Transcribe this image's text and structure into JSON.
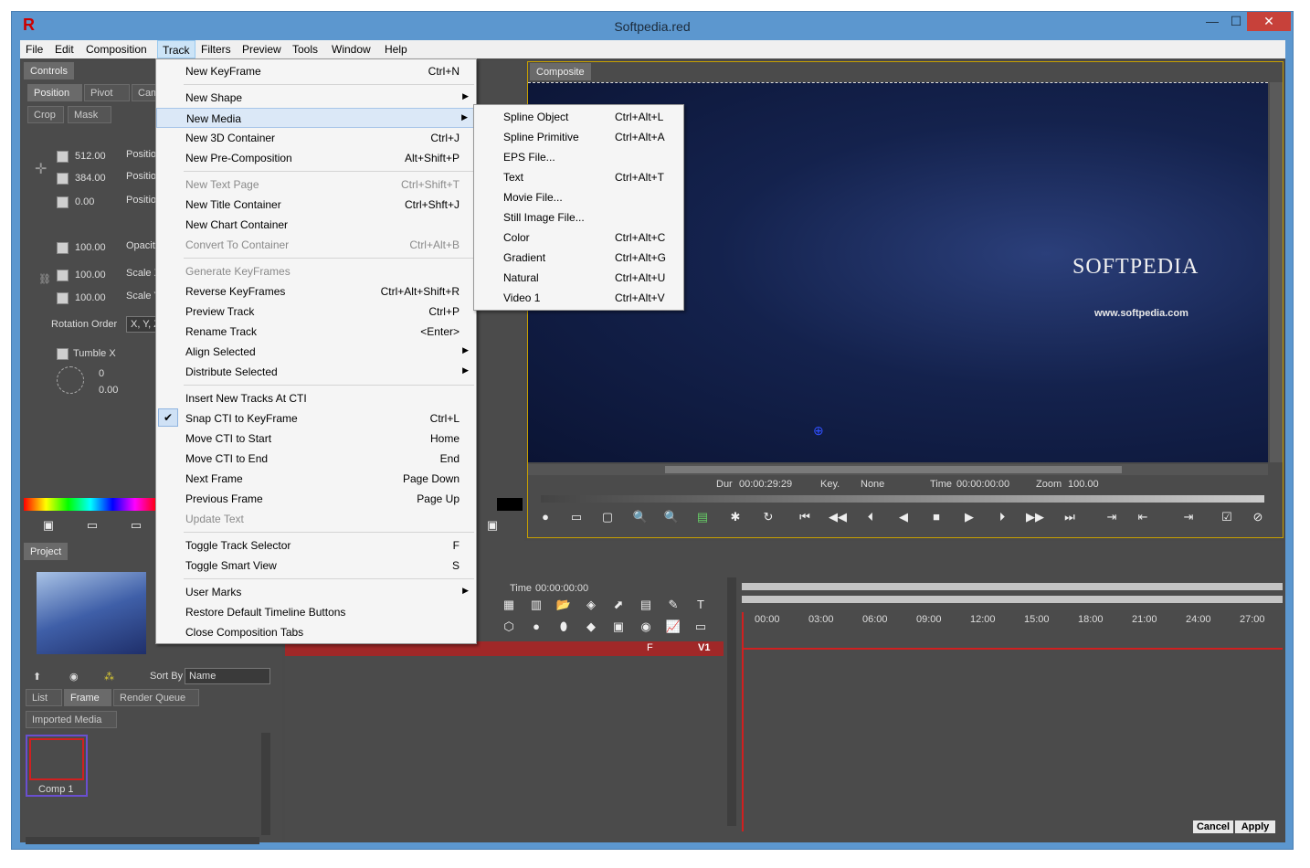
{
  "window": {
    "title": "Softpedia.red",
    "app_icon": "R",
    "minimize_glyph": "—",
    "maximize_glyph": "☐",
    "close_glyph": "✕"
  },
  "menubar": [
    "File",
    "Edit",
    "Composition",
    "Track",
    "Filters",
    "Preview",
    "Tools",
    "Window",
    "Help"
  ],
  "controls_panel": {
    "title": "Controls",
    "tabs": [
      "Position",
      "Pivot",
      "Cam"
    ],
    "tabs2": [
      "Crop",
      "Mask"
    ],
    "values": [
      "512.00",
      "384.00",
      "0.00",
      "100.00",
      "100.00",
      "100.00"
    ],
    "labels": [
      "Position",
      "Position",
      "Position",
      "Opacity",
      "Scale X",
      "Scale Y"
    ],
    "rotation_order_label": "Rotation Order",
    "rotation_order_value": "X, Y, Z",
    "tumble_label": "Tumble X",
    "tumble_values": [
      "0",
      "0.00"
    ]
  },
  "project_panel": {
    "title": "Project",
    "sort_by_label": "Sort By",
    "sort_by_value": "Name",
    "tabs": [
      "List",
      "Frame",
      "Render Queue"
    ],
    "tab_imported": "Imported Media",
    "item": "Comp 1"
  },
  "composite_panel": {
    "title": "Composite",
    "watermark_main": "SOFTPEDIA",
    "watermark_url": "www.softpedia.com",
    "dur_label": "Dur",
    "dur_value": "00:00:29:29",
    "key_label": "Key.",
    "key_value": "None",
    "time_label": "Time",
    "time_value": "00:00:00:00",
    "zoom_label": "Zoom",
    "zoom_value": "100.00"
  },
  "timeline": {
    "time_label": "Time",
    "time_value": "00:00:00:00",
    "ticks": [
      "00:00",
      "03:00",
      "06:00",
      "09:00",
      "12:00",
      "15:00",
      "18:00",
      "21:00",
      "24:00",
      "27:00"
    ],
    "track_flags": "F",
    "track_name": "V1",
    "cancel": "Cancel",
    "apply": "Apply"
  },
  "track_menu": [
    {
      "label": "New KeyFrame",
      "shortcut": "Ctrl+N"
    },
    {
      "sep": true
    },
    {
      "label": "New Shape",
      "submenu": true
    },
    {
      "label": "New Media",
      "submenu": true,
      "highlight": true
    },
    {
      "label": "New 3D Container",
      "shortcut": "Ctrl+J"
    },
    {
      "label": "New Pre-Composition",
      "shortcut": "Alt+Shift+P"
    },
    {
      "sep": true
    },
    {
      "label": "New Text Page",
      "shortcut": "Ctrl+Shift+T",
      "disabled": true
    },
    {
      "label": "New Title Container",
      "shortcut": "Ctrl+Shft+J"
    },
    {
      "label": "New Chart Container"
    },
    {
      "label": "Convert To Container",
      "shortcut": "Ctrl+Alt+B",
      "disabled": true
    },
    {
      "sep": true
    },
    {
      "label": "Generate KeyFrames",
      "disabled": true
    },
    {
      "label": "Reverse KeyFrames",
      "shortcut": "Ctrl+Alt+Shift+R"
    },
    {
      "label": "Preview Track",
      "shortcut": "Ctrl+P"
    },
    {
      "label": "Rename Track",
      "shortcut": "<Enter>"
    },
    {
      "label": "Align Selected",
      "submenu": true
    },
    {
      "label": "Distribute Selected",
      "submenu": true
    },
    {
      "sep": true
    },
    {
      "label": "Insert New Tracks At CTI"
    },
    {
      "label": "Snap CTI to KeyFrame",
      "shortcut": "Ctrl+L",
      "checked": true
    },
    {
      "label": "Move CTI to Start",
      "shortcut": "Home"
    },
    {
      "label": "Move CTI to End",
      "shortcut": "End"
    },
    {
      "label": "Next Frame",
      "shortcut": "Page Down"
    },
    {
      "label": "Previous Frame",
      "shortcut": "Page Up"
    },
    {
      "label": "Update Text",
      "disabled": true
    },
    {
      "sep": true
    },
    {
      "label": "Toggle Track Selector",
      "shortcut": "F"
    },
    {
      "label": "Toggle Smart View",
      "shortcut": "S"
    },
    {
      "sep": true
    },
    {
      "label": "User Marks",
      "submenu": true
    },
    {
      "label": "Restore Default Timeline Buttons"
    },
    {
      "label": "Close Composition Tabs"
    }
  ],
  "new_media_menu": [
    {
      "label": "Spline Object",
      "shortcut": "Ctrl+Alt+L"
    },
    {
      "label": "Spline Primitive",
      "shortcut": "Ctrl+Alt+A"
    },
    {
      "label": "EPS File..."
    },
    {
      "label": "Text",
      "shortcut": "Ctrl+Alt+T"
    },
    {
      "label": "Movie File..."
    },
    {
      "label": "Still Image File..."
    },
    {
      "label": "Color",
      "shortcut": "Ctrl+Alt+C"
    },
    {
      "label": "Gradient",
      "shortcut": "Ctrl+Alt+G"
    },
    {
      "label": "Natural",
      "shortcut": "Ctrl+Alt+U"
    },
    {
      "label": "Video 1",
      "shortcut": "Ctrl+Alt+V"
    }
  ]
}
